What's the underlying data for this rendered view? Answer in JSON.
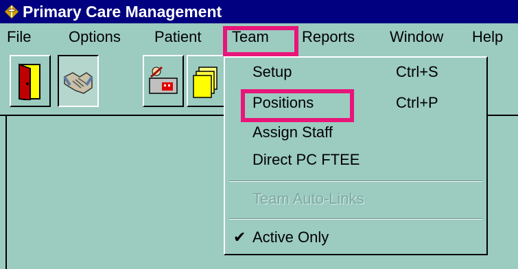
{
  "window": {
    "title": "Primary Care Management",
    "icon": "caduceus-icon"
  },
  "menubar": {
    "file": "File",
    "options": "Options",
    "patient": "Patient",
    "team": "Team",
    "reports": "Reports",
    "window": "Window",
    "help": "Help"
  },
  "toolbar": {
    "buttons": [
      {
        "icon": "exit-door-icon"
      },
      {
        "icon": "handshake-icon",
        "pressed": true
      },
      {
        "icon": "patient-doctor-icon"
      },
      {
        "icon": "folders-icon"
      }
    ]
  },
  "team_menu": {
    "setup": {
      "label": "Setup",
      "shortcut": "Ctrl+S"
    },
    "positions": {
      "label": "Positions",
      "shortcut": "Ctrl+P"
    },
    "assign_staff": {
      "label": "Assign Staff"
    },
    "direct_pc_ftee": {
      "label": "Direct PC FTEE"
    },
    "team_auto_links": {
      "label": "Team Auto-Links",
      "enabled": false
    },
    "active_only": {
      "label": "Active Only",
      "checked": true,
      "check_glyph": "✔"
    }
  },
  "annotations": {
    "highlight_color": "#e8157a"
  }
}
